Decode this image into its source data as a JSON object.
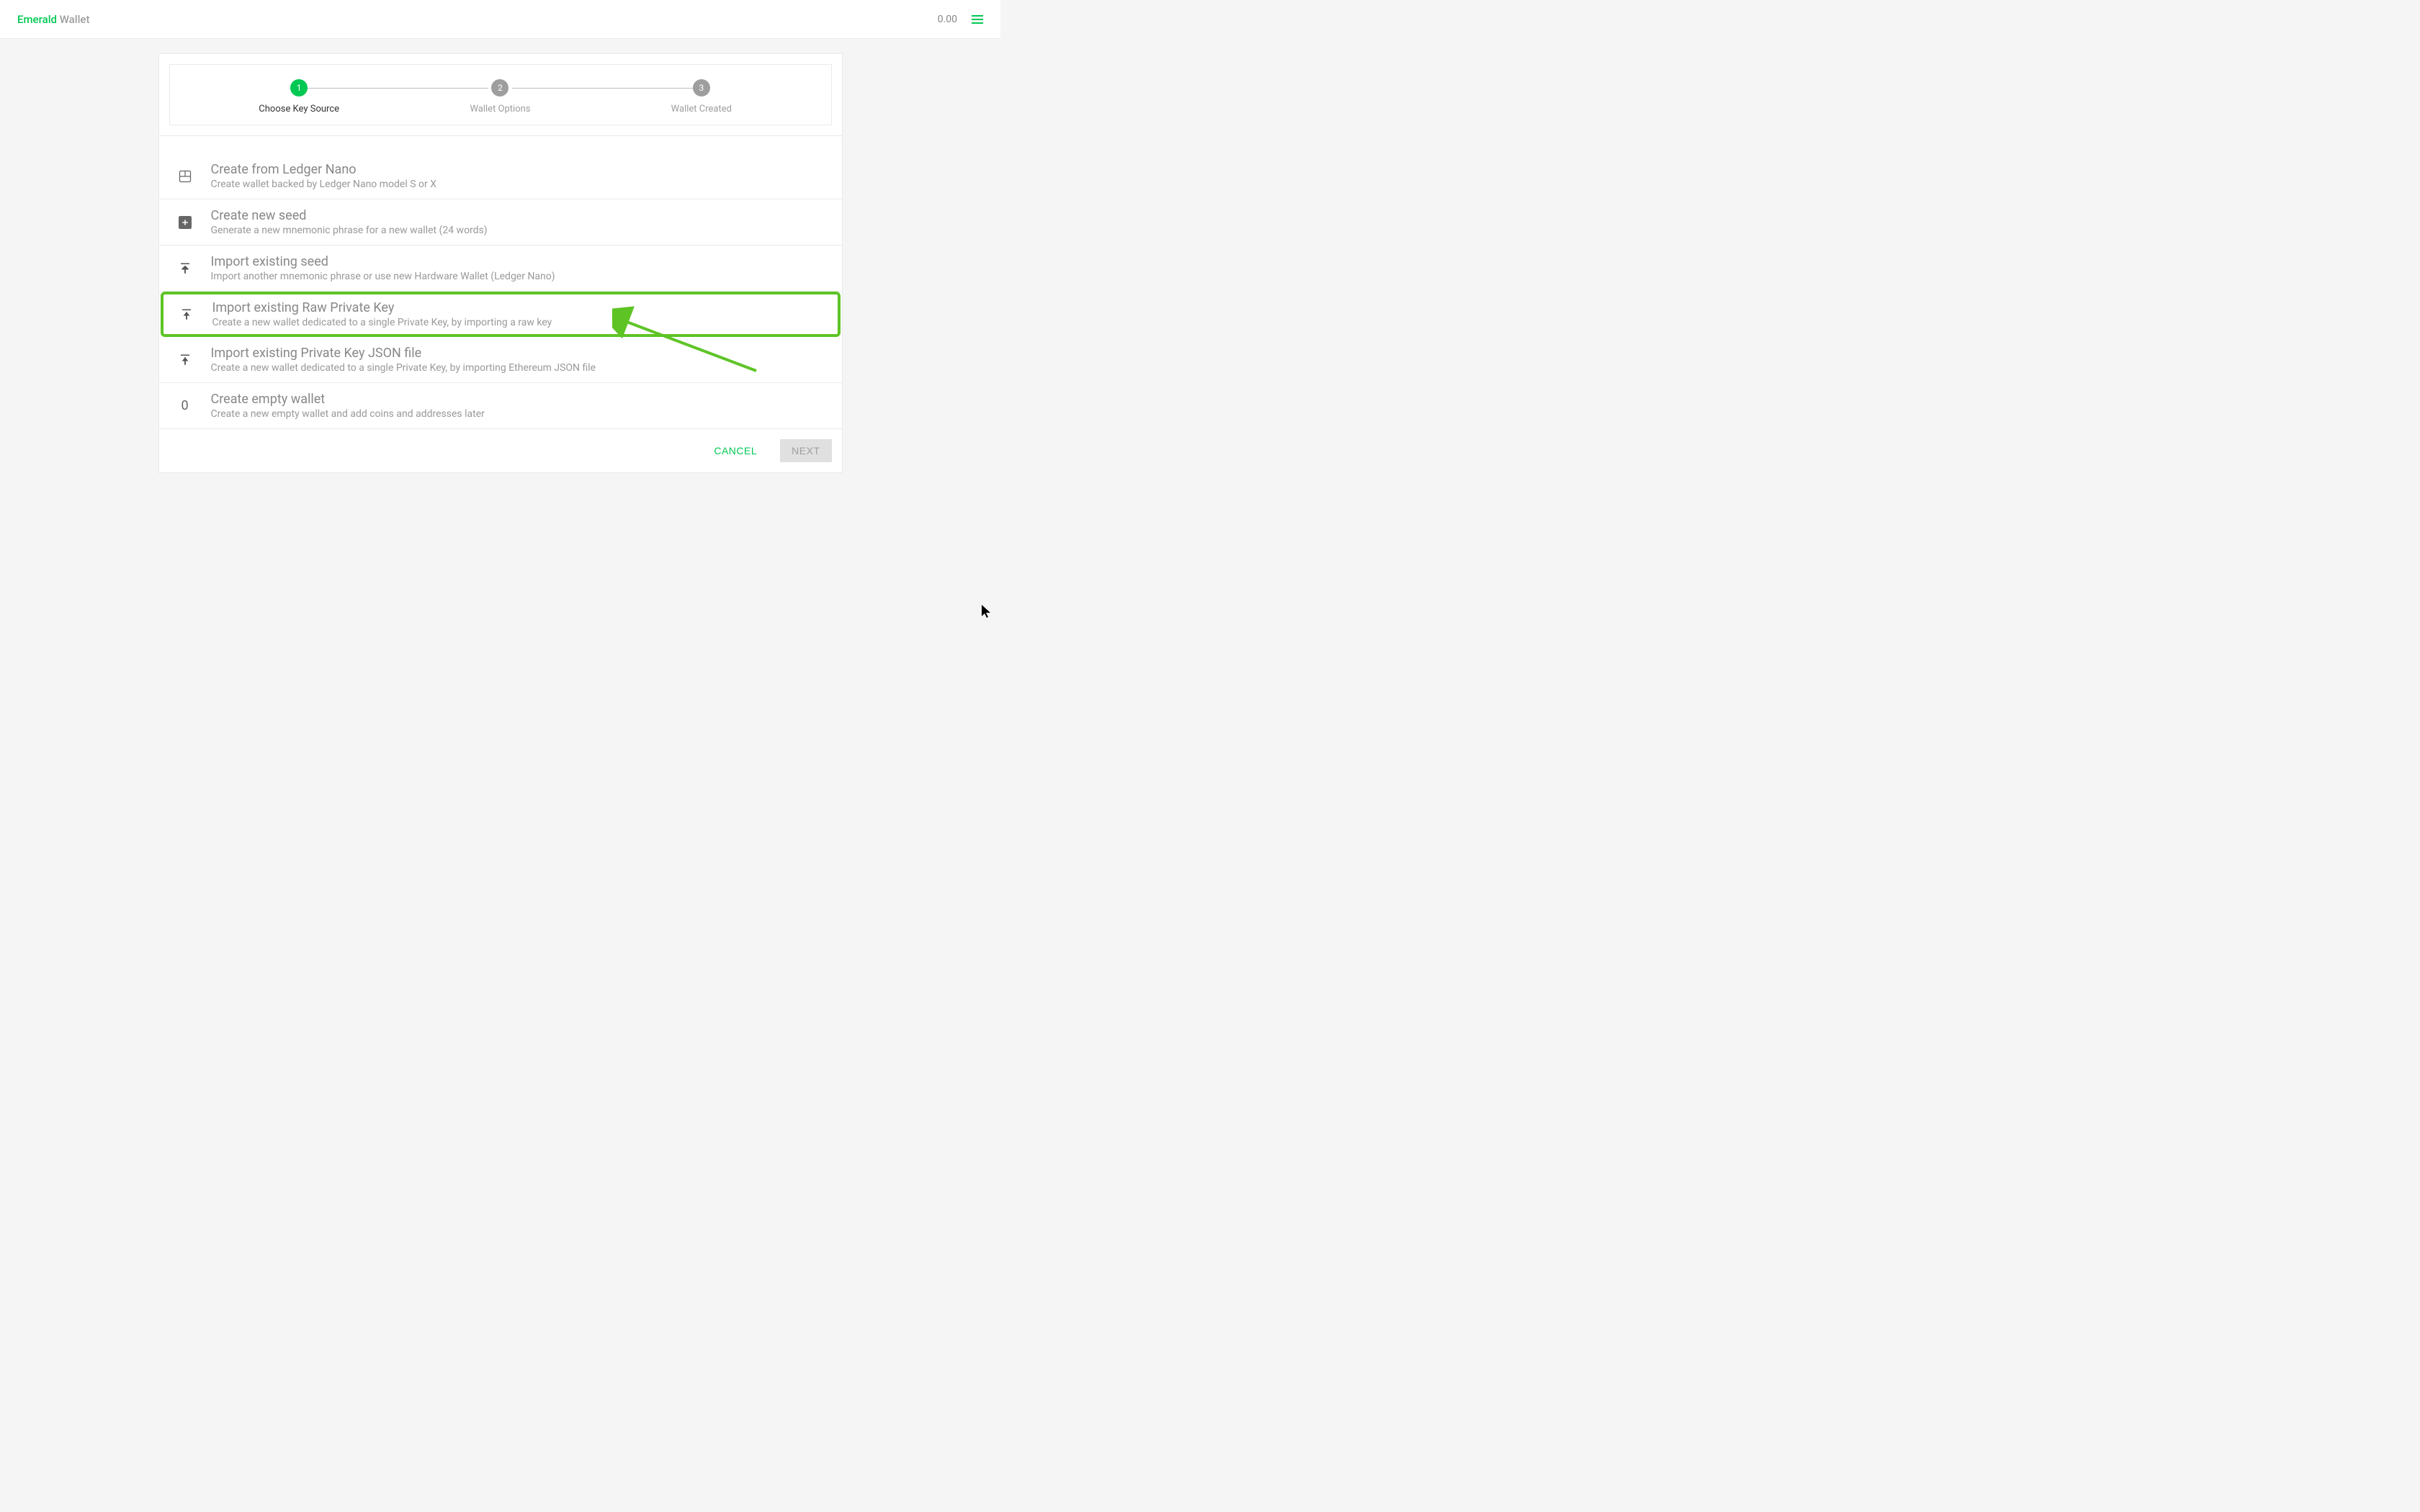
{
  "header": {
    "logo_emerald": "Emerald",
    "logo_wallet": " Wallet",
    "balance": "0.00"
  },
  "stepper": {
    "steps": [
      {
        "number": "1",
        "label": "Choose Key Source",
        "active": true
      },
      {
        "number": "2",
        "label": "Wallet Options",
        "active": false
      },
      {
        "number": "3",
        "label": "Wallet Created",
        "active": false
      }
    ]
  },
  "options": [
    {
      "icon": "ledger-icon",
      "title": "Create from Ledger Nano",
      "desc": "Create wallet backed by Ledger Nano model S or X",
      "highlighted": false
    },
    {
      "icon": "plus-icon",
      "title": "Create new seed",
      "desc": "Generate a new mnemonic phrase for a new wallet (24 words)",
      "highlighted": false
    },
    {
      "icon": "import-icon",
      "title": "Import existing seed",
      "desc": "Import another mnemonic phrase or use new Hardware Wallet (Ledger Nano)",
      "highlighted": false
    },
    {
      "icon": "import-icon",
      "title": "Import existing Raw Private Key",
      "desc": "Create a new wallet dedicated to a single Private Key, by importing a raw key",
      "highlighted": true
    },
    {
      "icon": "import-icon",
      "title": "Import existing Private Key JSON file",
      "desc": "Create a new wallet dedicated to a single Private Key, by importing Ethereum JSON file",
      "highlighted": false
    },
    {
      "icon": "zero-icon",
      "title": "Create empty wallet",
      "desc": "Create a new empty wallet and add coins and addresses later",
      "highlighted": false
    }
  ],
  "buttons": {
    "cancel": "CANCEL",
    "next": "NEXT"
  }
}
